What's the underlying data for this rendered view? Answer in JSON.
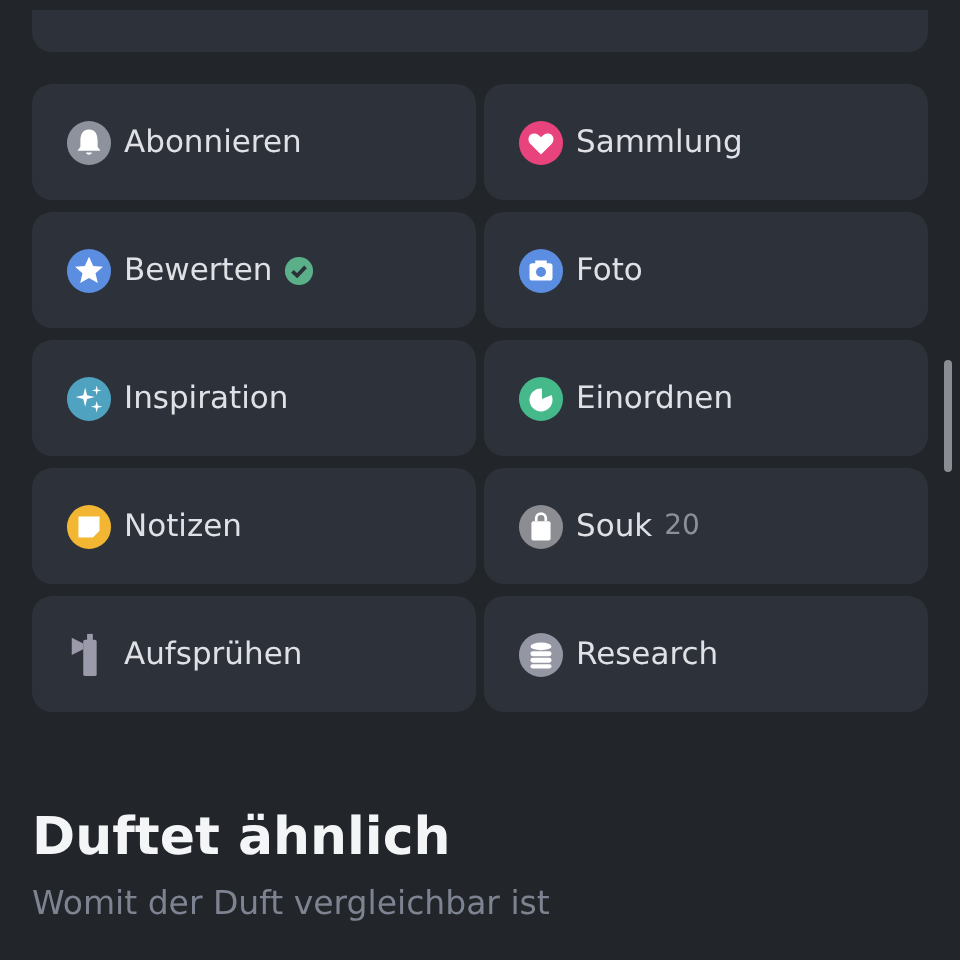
{
  "actions": [
    {
      "label": "Abonnieren",
      "kind": "bell",
      "color": "#8e929c"
    },
    {
      "label": "Sammlung",
      "kind": "heart",
      "color": "#e8437c"
    },
    {
      "label": "Bewerten",
      "kind": "star",
      "color": "#5b8de0",
      "verified": true
    },
    {
      "label": "Foto",
      "kind": "camera",
      "color": "#5b8de0"
    },
    {
      "label": "Inspiration",
      "kind": "sparkles",
      "color": "#4fa3c0"
    },
    {
      "label": "Einordnen",
      "kind": "pie",
      "color": "#45b98a"
    },
    {
      "label": "Notizen",
      "kind": "note",
      "color": "#f2b632"
    },
    {
      "label": "Souk",
      "kind": "bag",
      "color": "#8c8d92",
      "count": "20"
    },
    {
      "label": "Aufsprühen",
      "kind": "spray",
      "color": "#9a9aab"
    },
    {
      "label": "Research",
      "kind": "database",
      "color": "#9497a3"
    }
  ],
  "section": {
    "title": "Duftet ähnlich",
    "subtitle": "Womit der Duft vergleichbar ist"
  }
}
